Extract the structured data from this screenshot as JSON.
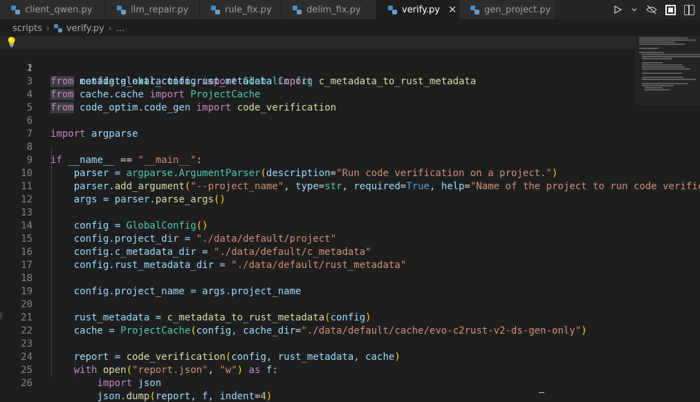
{
  "tabs": [
    {
      "label": "client_qwen.py",
      "active": false
    },
    {
      "label": "llm_repair.py",
      "active": false
    },
    {
      "label": "rule_fix.py",
      "active": false
    },
    {
      "label": "delim_fix.py",
      "active": false
    },
    {
      "label": "verify.py",
      "active": true
    },
    {
      "label": "gen_project.py",
      "active": false
    }
  ],
  "tab_close_glyph": "✕",
  "breadcrumb": {
    "folder": "scripts",
    "file": "verify.py",
    "more": "..."
  },
  "editor": {
    "current_line": 1,
    "lines": [
      {
        "n": "1"
      },
      {
        "n": "2"
      },
      {
        "n": "3"
      },
      {
        "n": "4"
      },
      {
        "n": "5"
      },
      {
        "n": "6"
      },
      {
        "n": "7"
      },
      {
        "n": "8"
      },
      {
        "n": "9"
      },
      {
        "n": "10"
      },
      {
        "n": "11"
      },
      {
        "n": "12"
      },
      {
        "n": "13"
      },
      {
        "n": "14"
      },
      {
        "n": "15"
      },
      {
        "n": "16"
      },
      {
        "n": "17"
      },
      {
        "n": "18"
      },
      {
        "n": "19"
      },
      {
        "n": "20"
      },
      {
        "n": "21"
      },
      {
        "n": "22"
      },
      {
        "n": "23"
      },
      {
        "n": "24"
      },
      {
        "n": "25"
      },
      {
        "n": "26"
      }
    ],
    "tokens": {
      "from": "from",
      "import": "import",
      "if": "if",
      "with": "with",
      "as": "as",
      "l1_mod": "config.global_config",
      "l1_name": "GlobalConfig",
      "l2_mod": "metadata_extraction.rust_metadata",
      "l2_name": "c_metadata_to_rust_metadata",
      "l3_mod": "cache.cache",
      "l3_name": "ProjectCache",
      "l4_mod": "code_optim.code_gen",
      "l4_name": "code_verification",
      "l6_mod": "argparse",
      "l8_name": "__name__",
      "l8_eq": " == ",
      "l8_main": "\"__main__\"",
      "l8_colon": ":",
      "l9_a": "parser = ",
      "l9_b": "argparse.",
      "l9_c": "ArgumentParser",
      "l9_d": "description",
      "l9_e": "=",
      "l9_f": "\"Run code verification on a project.\"",
      "l10_a": "parser.",
      "l10_b": "add_argument",
      "l10_c": "\"--project_name\"",
      "l10_d": ", ",
      "l10_e": "type",
      "l10_f": "=",
      "l10_g": "str",
      "l10_h": "required",
      "l10_i": "True",
      "l10_j": "help",
      "l10_k": "\"Name of the project to run code verifica",
      "l11_a": "args = parser.",
      "l11_b": "parse_args",
      "l13_a": "config = ",
      "l13_b": "GlobalConfig",
      "l14_a": "config.project_dir = ",
      "l14_b": "\"./data/default/project\"",
      "l15_a": "config.c_metadata_dir = ",
      "l15_b": "\"./data/default/c_metadata\"",
      "l16_a": "config.rust_metadata_dir = ",
      "l16_b": "\"./data/default/rust_metadata\"",
      "l18_a": "config.project_name = args.project_name",
      "l20_a": "rust_metadata = ",
      "l20_b": "c_metadata_to_rust_metadata",
      "l20_c": "config",
      "l21_a": "cache = ",
      "l21_b": "ProjectCache",
      "l21_c": "config, ",
      "l21_d": "cache_dir",
      "l21_e": "\"./data/default/cache/evo-c2rust-v2-ds-gen-only\"",
      "l23_a": "report = ",
      "l23_b": "code_verification",
      "l23_c": "config, rust_metadata, cache",
      "l24_b": "open",
      "l24_c": "\"report.json\"",
      "l24_d": ", ",
      "l24_e": "\"w\"",
      "l24_f": " f:",
      "l25_b": "json",
      "l26_a": "json.",
      "l26_b": "dump",
      "l26_c": "report, f, ",
      "l26_d": "indent",
      "l26_e": "4",
      "open_p": "(",
      "close_p": ")",
      "comma": ", ",
      "eq": "="
    }
  },
  "colors": {
    "background": "#1e1e1e",
    "keyword": "#c586c0",
    "builtin_keyword": "#569cd6",
    "function": "#dcdcaa",
    "class": "#4ec9b0",
    "string": "#ce9178",
    "number": "#b5cea8",
    "parameter": "#9cdcfe"
  },
  "icons": {
    "run": "play-icon",
    "run_menu": "chevron-down-icon",
    "lightbulb": "lightbulb-icon",
    "close": "close-icon"
  }
}
